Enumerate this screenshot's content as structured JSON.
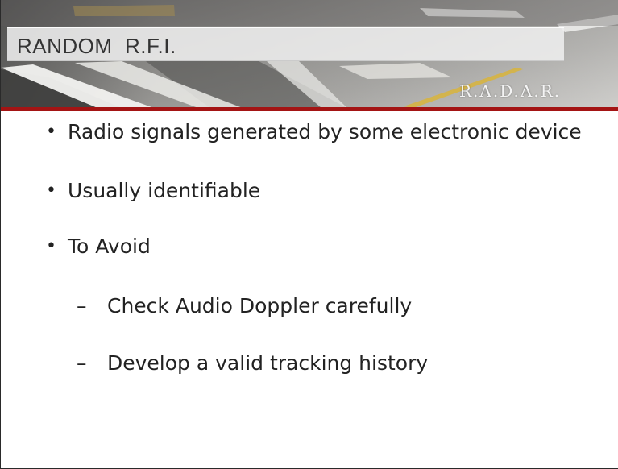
{
  "header": {
    "title": "RANDOM  R.F.I.",
    "brand": "R.A.D.A.R."
  },
  "bullets": [
    {
      "level": 1,
      "marker": "•",
      "text": "Radio signals generated by some electronic device"
    },
    {
      "level": 1,
      "marker": "•",
      "text": "Usually identifiable"
    },
    {
      "level": 1,
      "marker": "•",
      "text": "To Avoid"
    },
    {
      "level": 2,
      "marker": "–",
      "text": "Check Audio Doppler carefully"
    },
    {
      "level": 2,
      "marker": "–",
      "text": "Develop a valid tracking history"
    }
  ],
  "colors": {
    "accent_rule": "#a41414",
    "text": "#222222"
  }
}
